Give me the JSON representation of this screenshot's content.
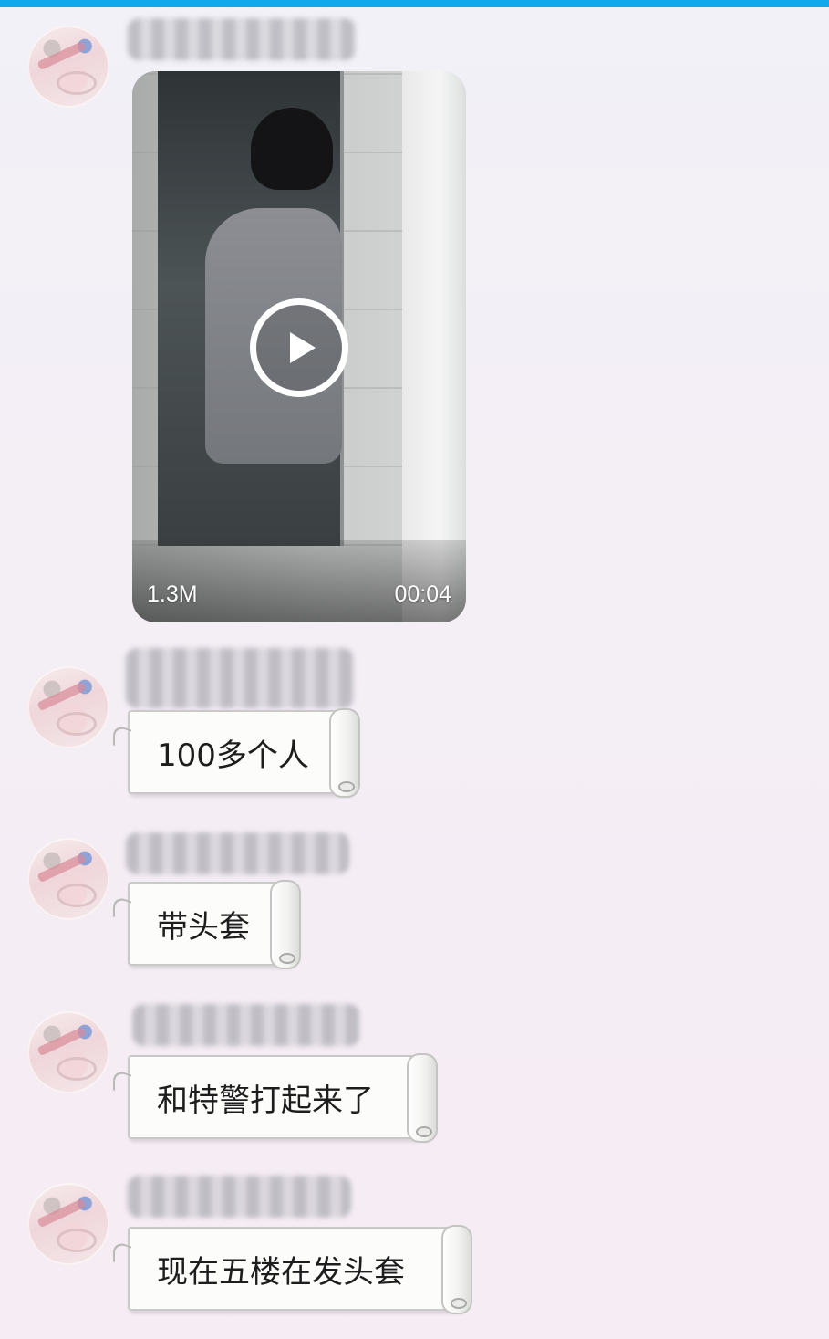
{
  "chat": {
    "video": {
      "size": "1.3M",
      "duration": "00:04"
    },
    "messages": [
      {
        "text": "100多个人"
      },
      {
        "text": "带头套"
      },
      {
        "text": "和特警打起来了"
      },
      {
        "text": "现在五楼在发头套"
      }
    ]
  },
  "colors": {
    "top_bar": "#12a9ec",
    "bubble_bg": "#fcfcfb",
    "page_bg": "#f3eff6"
  }
}
